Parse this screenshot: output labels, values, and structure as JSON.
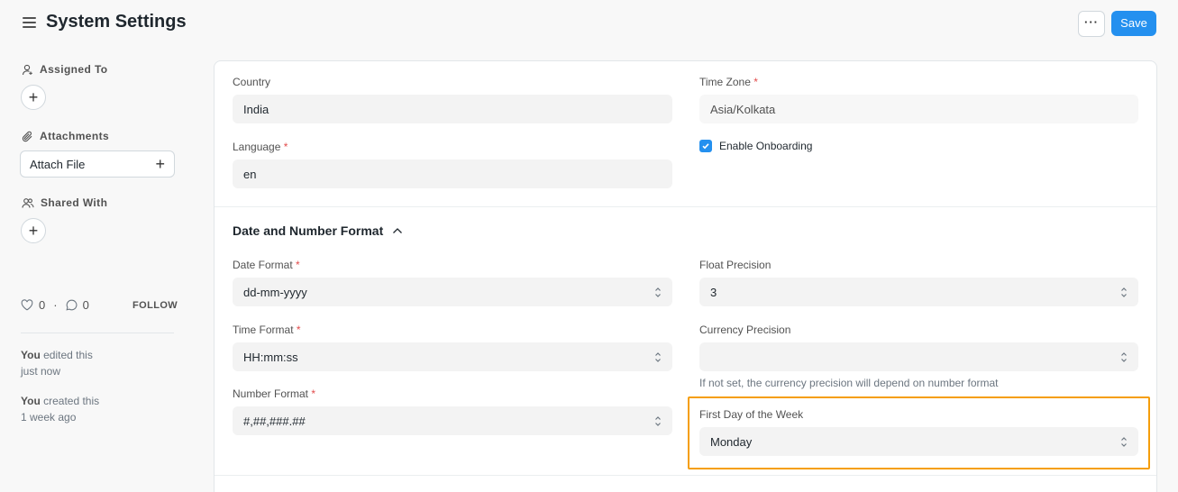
{
  "header": {
    "title": "System Settings",
    "more_label": "···",
    "save_label": "Save"
  },
  "sidebar": {
    "assigned_to": "Assigned To",
    "attachments": "Attachments",
    "attach_file": "Attach File",
    "shared_with": "Shared With",
    "likes": "0",
    "comments": "0",
    "follow": "FOLLOW",
    "activity": [
      {
        "actor": "You",
        "action": " edited this",
        "when": "just now"
      },
      {
        "actor": "You",
        "action": " created this",
        "when": "1 week ago"
      }
    ]
  },
  "form": {
    "country": {
      "label": "Country",
      "value": "India"
    },
    "time_zone": {
      "label": "Time Zone",
      "value": "Asia/Kolkata",
      "required": "*"
    },
    "language": {
      "label": "Language",
      "value": "en",
      "required": "*"
    },
    "enable_onboarding": {
      "label": "Enable Onboarding",
      "checked": true
    },
    "section_title": "Date and Number Format",
    "date_format": {
      "label": "Date Format",
      "value": "dd-mm-yyyy",
      "required": "*"
    },
    "float_precision": {
      "label": "Float Precision",
      "value": "3"
    },
    "time_format": {
      "label": "Time Format",
      "value": "HH:mm:ss",
      "required": "*"
    },
    "currency_precision": {
      "label": "Currency Precision",
      "value": "",
      "help": "If not set, the currency precision will depend on number format"
    },
    "number_format": {
      "label": "Number Format",
      "value": "#,##,###.##",
      "required": "*"
    },
    "first_day": {
      "label": "First Day of the Week",
      "value": "Monday"
    }
  },
  "colors": {
    "primary": "#2490ef",
    "highlight": "#f59e0b",
    "required": "#e24c4c"
  }
}
